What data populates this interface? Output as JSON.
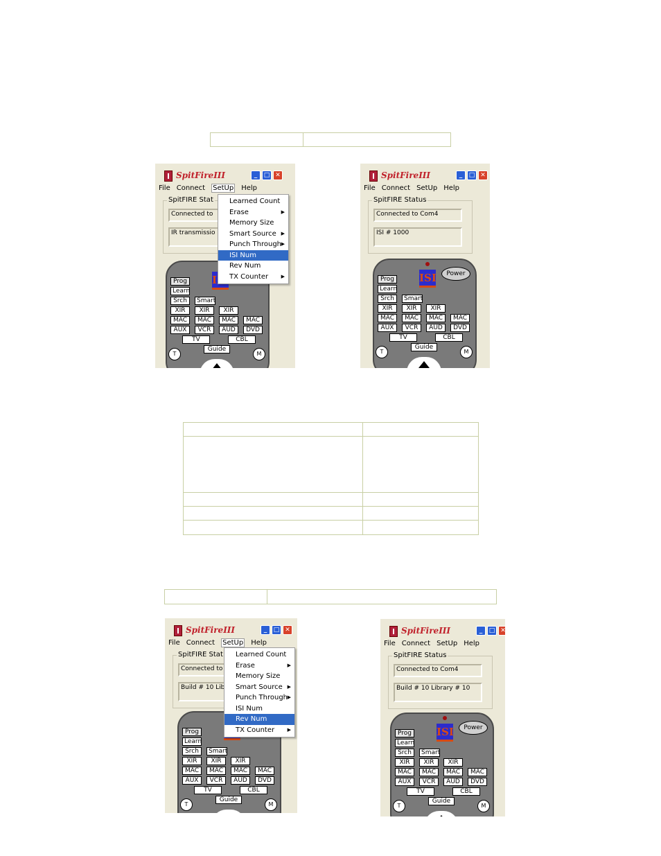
{
  "windows": [
    {
      "title": "SpitFireIII",
      "menu": [
        "File",
        "Connect",
        "SetUp",
        "Help"
      ],
      "status_label": "SpitFIRE Stat",
      "status_line1": "Connected to",
      "status_line2": "IR transmissio",
      "dropdown": {
        "items": [
          {
            "label": "Learned Count",
            "submenu": false
          },
          {
            "label": "Erase",
            "submenu": true
          },
          {
            "label": "Memory Size",
            "submenu": false
          },
          {
            "label": "Smart Source",
            "submenu": true
          },
          {
            "label": "Punch Through",
            "submenu": true
          },
          {
            "label": "ISI Num",
            "submenu": false
          },
          {
            "label": "Rev Num",
            "submenu": false
          },
          {
            "label": "TX Counter",
            "submenu": true
          }
        ],
        "highlighted": "ISI Num"
      }
    },
    {
      "title": "SpitFireIII",
      "menu": [
        "File",
        "Connect",
        "SetUp",
        "Help"
      ],
      "status_label": "SpitFIRE Status",
      "status_line1": "Connected to Com4",
      "status_line2": "ISI # 1000"
    },
    {
      "title": "SpitFireIII",
      "menu": [
        "File",
        "Connect",
        "SetUp",
        "Help"
      ],
      "status_label": "SpitFIRE Stat",
      "status_line1": "Connected to",
      "status_line2": "Build # 10 Lib",
      "dropdown": {
        "items": [
          {
            "label": "Learned Count",
            "submenu": false
          },
          {
            "label": "Erase",
            "submenu": true
          },
          {
            "label": "Memory Size",
            "submenu": false
          },
          {
            "label": "Smart Source",
            "submenu": true
          },
          {
            "label": "Punch Through",
            "submenu": true
          },
          {
            "label": "ISI Num",
            "submenu": false
          },
          {
            "label": "Rev Num",
            "submenu": false
          },
          {
            "label": "TX Counter",
            "submenu": true
          }
        ],
        "highlighted": "Rev Num"
      }
    },
    {
      "title": "SpitFireIII",
      "menu": [
        "File",
        "Connect",
        "SetUp",
        "Help"
      ],
      "status_label": "SpitFIRE Status",
      "status_line1": "Connected to Com4",
      "status_line2": "Build # 10 Library # 10"
    }
  ],
  "remote": {
    "logo": "ISI",
    "power": "Power",
    "prog": "Prog",
    "learn": "Learn",
    "srch": "Srch",
    "smart": "Smart",
    "xir": "XIR",
    "mac": "MAC",
    "aux": "AUX",
    "vcr": "VCR",
    "aud": "AUD",
    "dvd": "DVD",
    "tv": "TV",
    "cbl": "CBL",
    "guide": "Guide",
    "t": "T",
    "m": "M"
  },
  "icons": {
    "app": "app-icon",
    "minimize": "minimize-icon",
    "maximize": "maximize-icon",
    "close": "close-icon",
    "submenu": "submenu-arrow-icon"
  }
}
